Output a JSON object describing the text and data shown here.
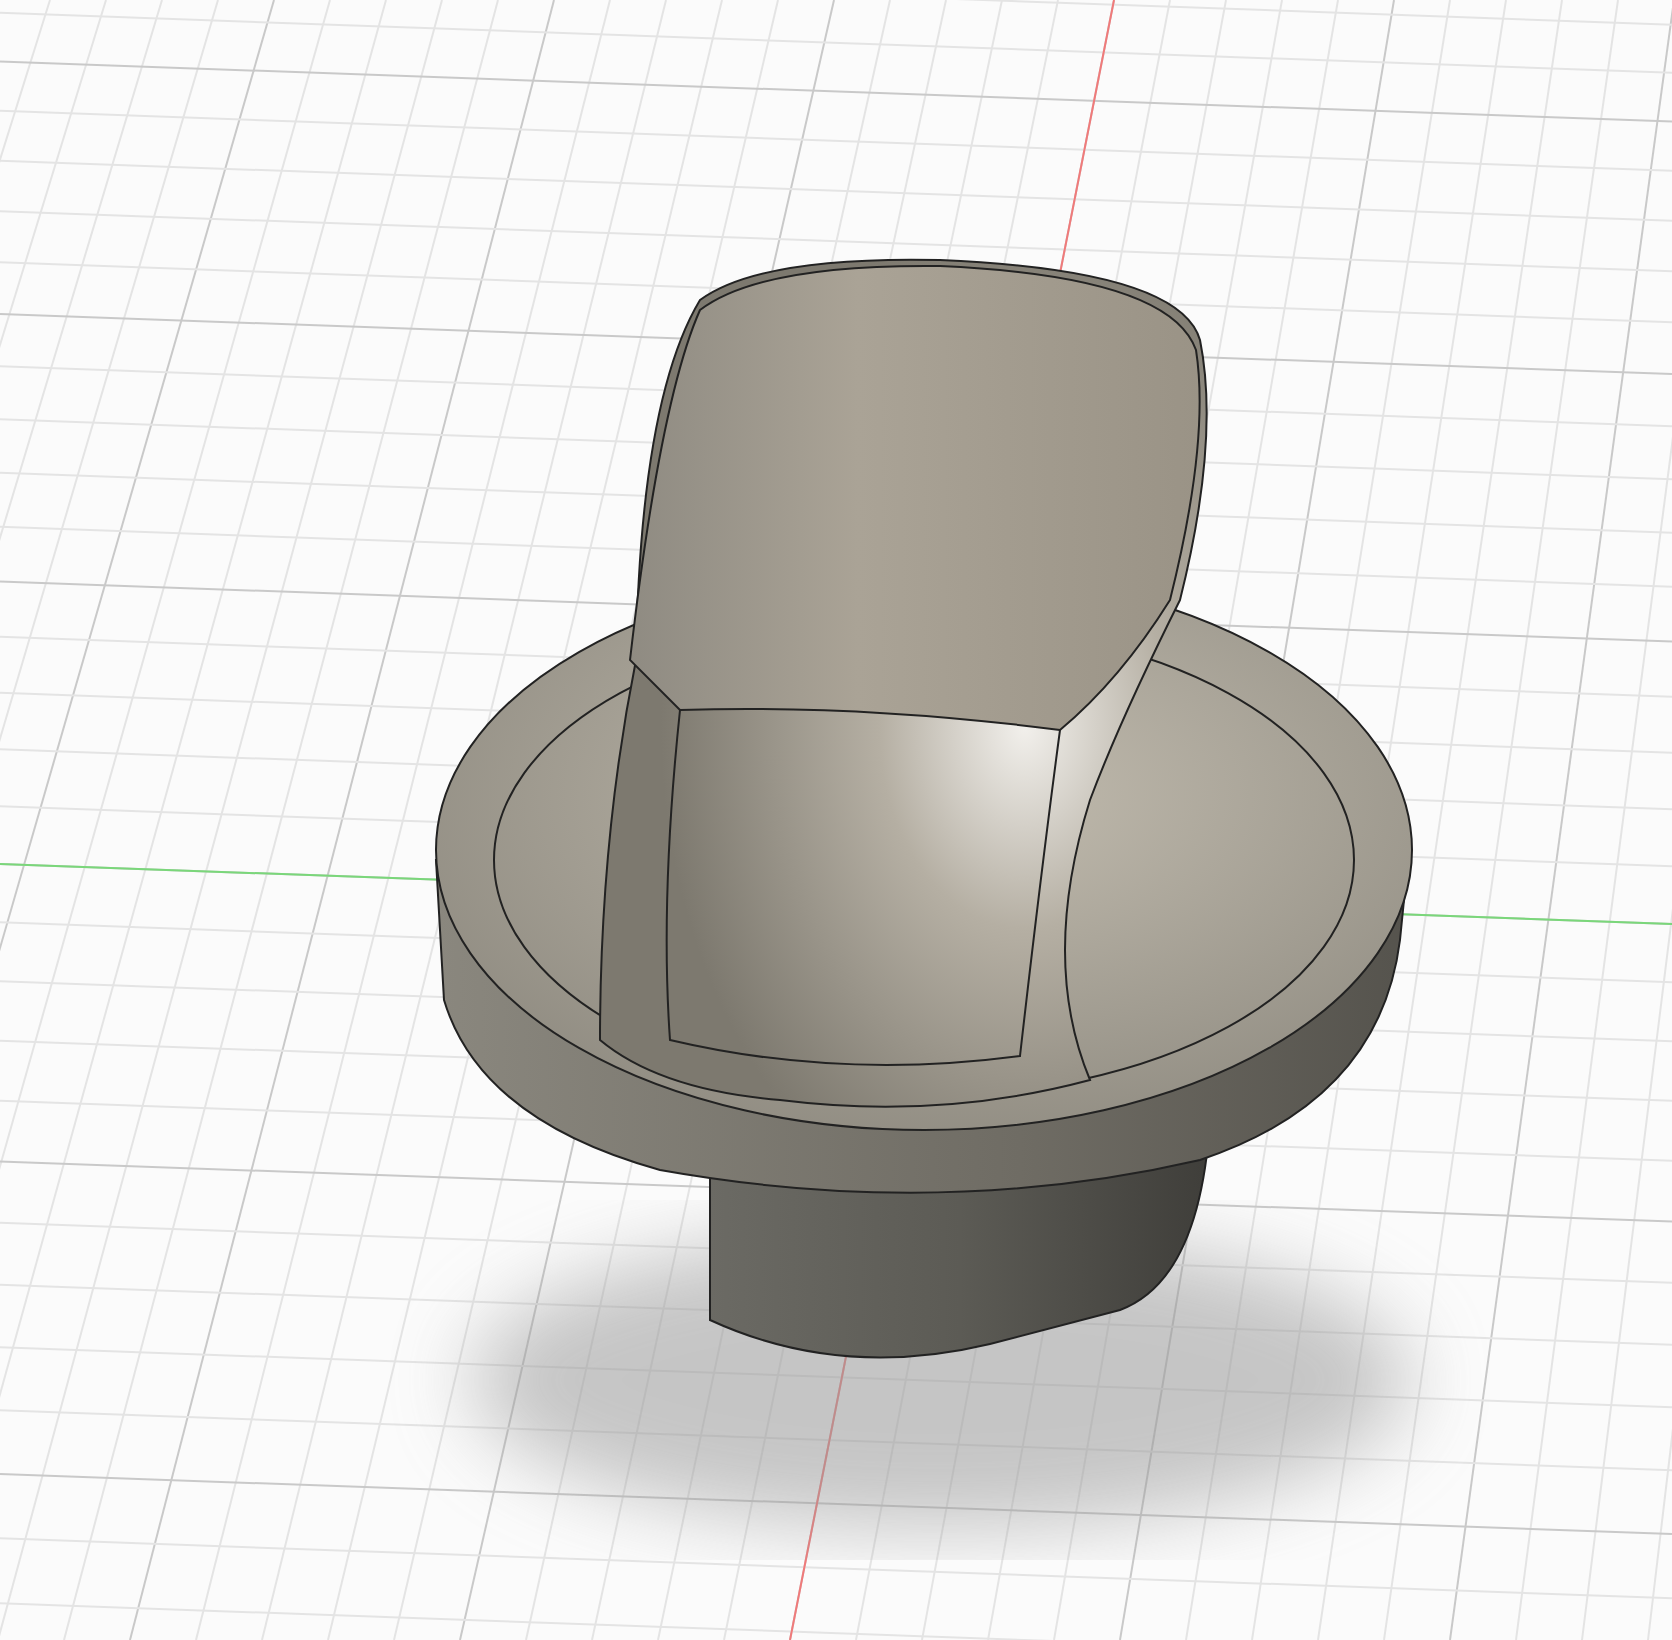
{
  "viewport": {
    "grid": true,
    "axes": true,
    "model": {
      "kind": "knob"
    }
  }
}
